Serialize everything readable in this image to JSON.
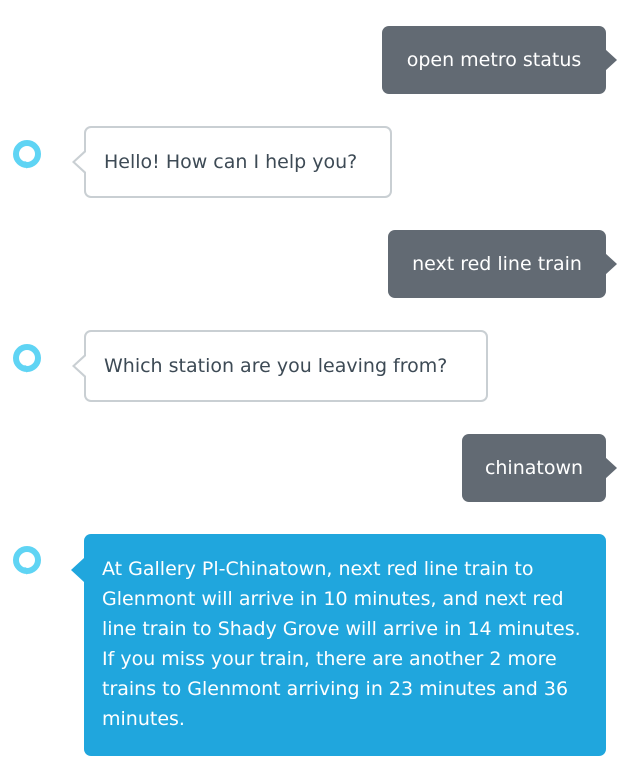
{
  "colors": {
    "user_bubble": "#626a73",
    "bot_bubble_border": "#c9cfd3",
    "bot_text": "#3d4a55",
    "bot_highlight_bubble": "#20a6dd",
    "avatar_ring": "#5fd4f4"
  },
  "icons": {
    "assistant": "alexa-ring-icon"
  },
  "conversation": [
    {
      "sender": "user",
      "text": "open metro status"
    },
    {
      "sender": "assistant",
      "text": "Hello! How can I help you?"
    },
    {
      "sender": "user",
      "text": "next red line train"
    },
    {
      "sender": "assistant",
      "text": "Which station are you leaving from?"
    },
    {
      "sender": "user",
      "text": "chinatown"
    },
    {
      "sender": "assistant",
      "text": "At Gallery Pl-Chinatown, next red line train to Glenmont will arrive in 10 minutes, and next red line train to Shady Grove will arrive in 14 minutes. If you miss your train, there are another 2 more trains to Glenmont arriving in 23 minutes and 36 minutes."
    }
  ]
}
